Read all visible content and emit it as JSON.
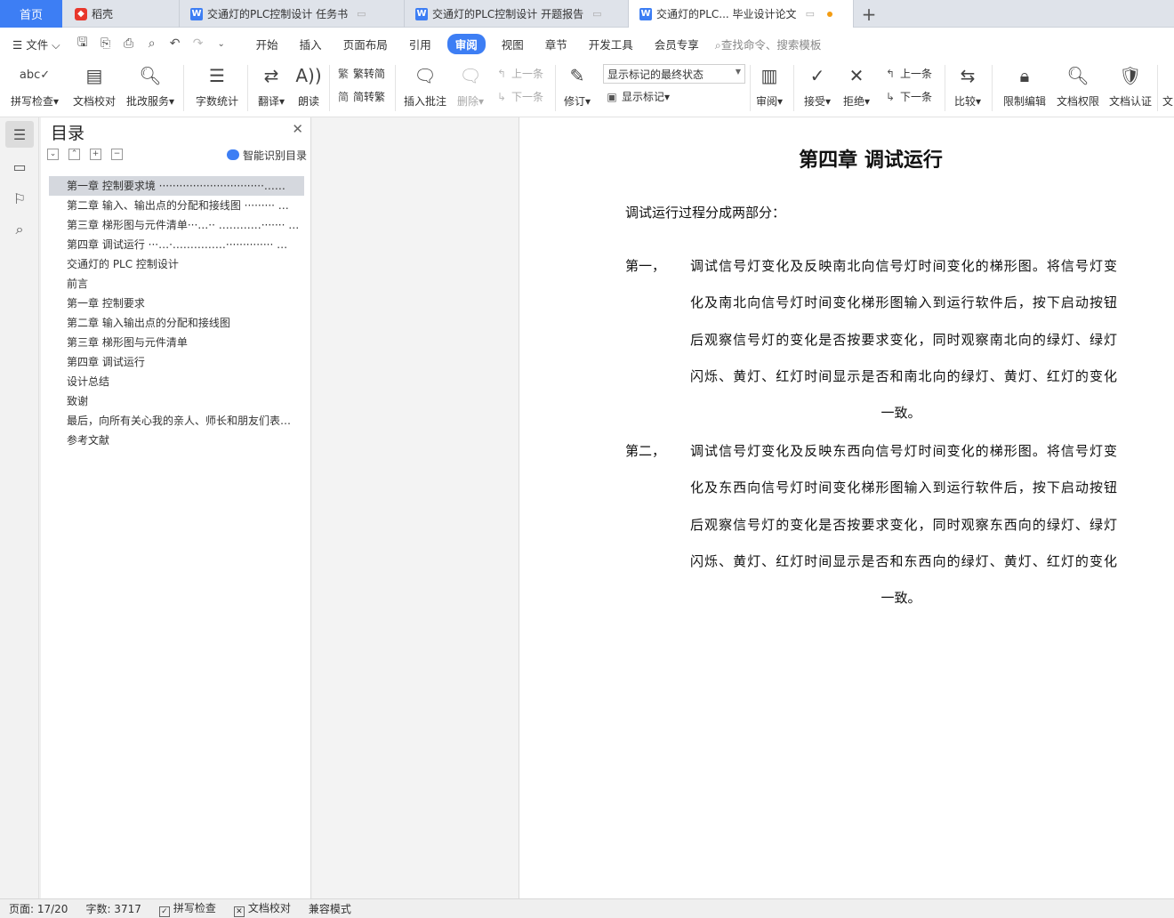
{
  "tabs": {
    "home": "首页",
    "daoke": "稻壳",
    "doc1": "交通灯的PLC控制设计 任务书",
    "doc2": "交通灯的PLC控制设计 开题报告",
    "doc3": "交通灯的PLC... 毕业设计论文"
  },
  "menu": {
    "file": "文件",
    "items": [
      "开始",
      "插入",
      "页面布局",
      "引用",
      "审阅",
      "视图",
      "章节",
      "开发工具",
      "会员专享"
    ],
    "active": "审阅",
    "search": "查找命令、搜索模板"
  },
  "ribbon": {
    "spell_check": "拼写检查",
    "doc_proof": "文档校对",
    "revise_service": "批改服务",
    "word_count": "字数统计",
    "translate": "翻译",
    "read_aloud": "朗读",
    "trad_simp": "繁转简",
    "simp_trad": "简转繁",
    "insert_comment": "插入批注",
    "delete": "删除",
    "prev_comment": "上一条",
    "next_comment": "下一条",
    "track_changes": "修订",
    "markup_state": "显示标记的最终状态",
    "show_markup": "显示标记",
    "review": "审阅",
    "accept": "接受",
    "reject": "拒绝",
    "prev_change": "上一条",
    "next_change": "下一条",
    "compare": "比较",
    "restrict_edit": "限制编辑",
    "doc_permission": "文档权限",
    "doc_cert": "文档认证",
    "overflow": "文"
  },
  "toc": {
    "title": "目录",
    "smart": "智能识别目录",
    "items": [
      "第一章  控制要求境  ·······························……",
      "第二章  输入、输出点的分配和接线图  ·········  …",
      "第三章  梯形图与元件清单···…··  …………·······  …",
      "第四章  调试运行    ···…·……………··············  …",
      "交通灯的 PLC 控制设计",
      "前言",
      "第一章  控制要求",
      "第二章  输入输出点的分配和接线图",
      "第三章  梯形图与元件清单",
      "第四章  调试运行",
      "设计总结",
      "致谢",
      "最后，向所有关心我的亲人、师长和朋友们表…",
      "参考文献"
    ]
  },
  "document": {
    "chapter_title": "第四章  调试运行",
    "intro": "调试运行过程分成两部分：",
    "para1": {
      "label": "第一，",
      "lines": [
        "调试信号灯变化及反映南北向信号灯时间变化的梯形图。将信号灯变",
        "化及南北向信号灯时间变化梯形图输入到运行软件后，按下启动按钮",
        "后观察信号灯的变化是否按要求变化，同时观察南北向的绿灯、绿灯",
        "闪烁、黄灯、红灯时间显示是否和南北向的绿灯、黄灯、红灯的变化",
        "一致。"
      ]
    },
    "para2": {
      "label": "第二，",
      "lines": [
        "调试信号灯变化及反映东西向信号灯时间变化的梯形图。将信号灯变",
        "化及东西向信号灯时间变化梯形图输入到运行软件后，按下启动按钮",
        "后观察信号灯的变化是否按要求变化，同时观察东西向的绿灯、绿灯",
        "闪烁、黄灯、红灯时间显示是否和东西向的绿灯、黄灯、红灯的变化",
        "一致。"
      ]
    }
  },
  "status": {
    "page": "页面: 17/20",
    "words": "字数: 3717",
    "spell": "拼写检查",
    "proof": "文档校对",
    "compat": "兼容模式"
  }
}
